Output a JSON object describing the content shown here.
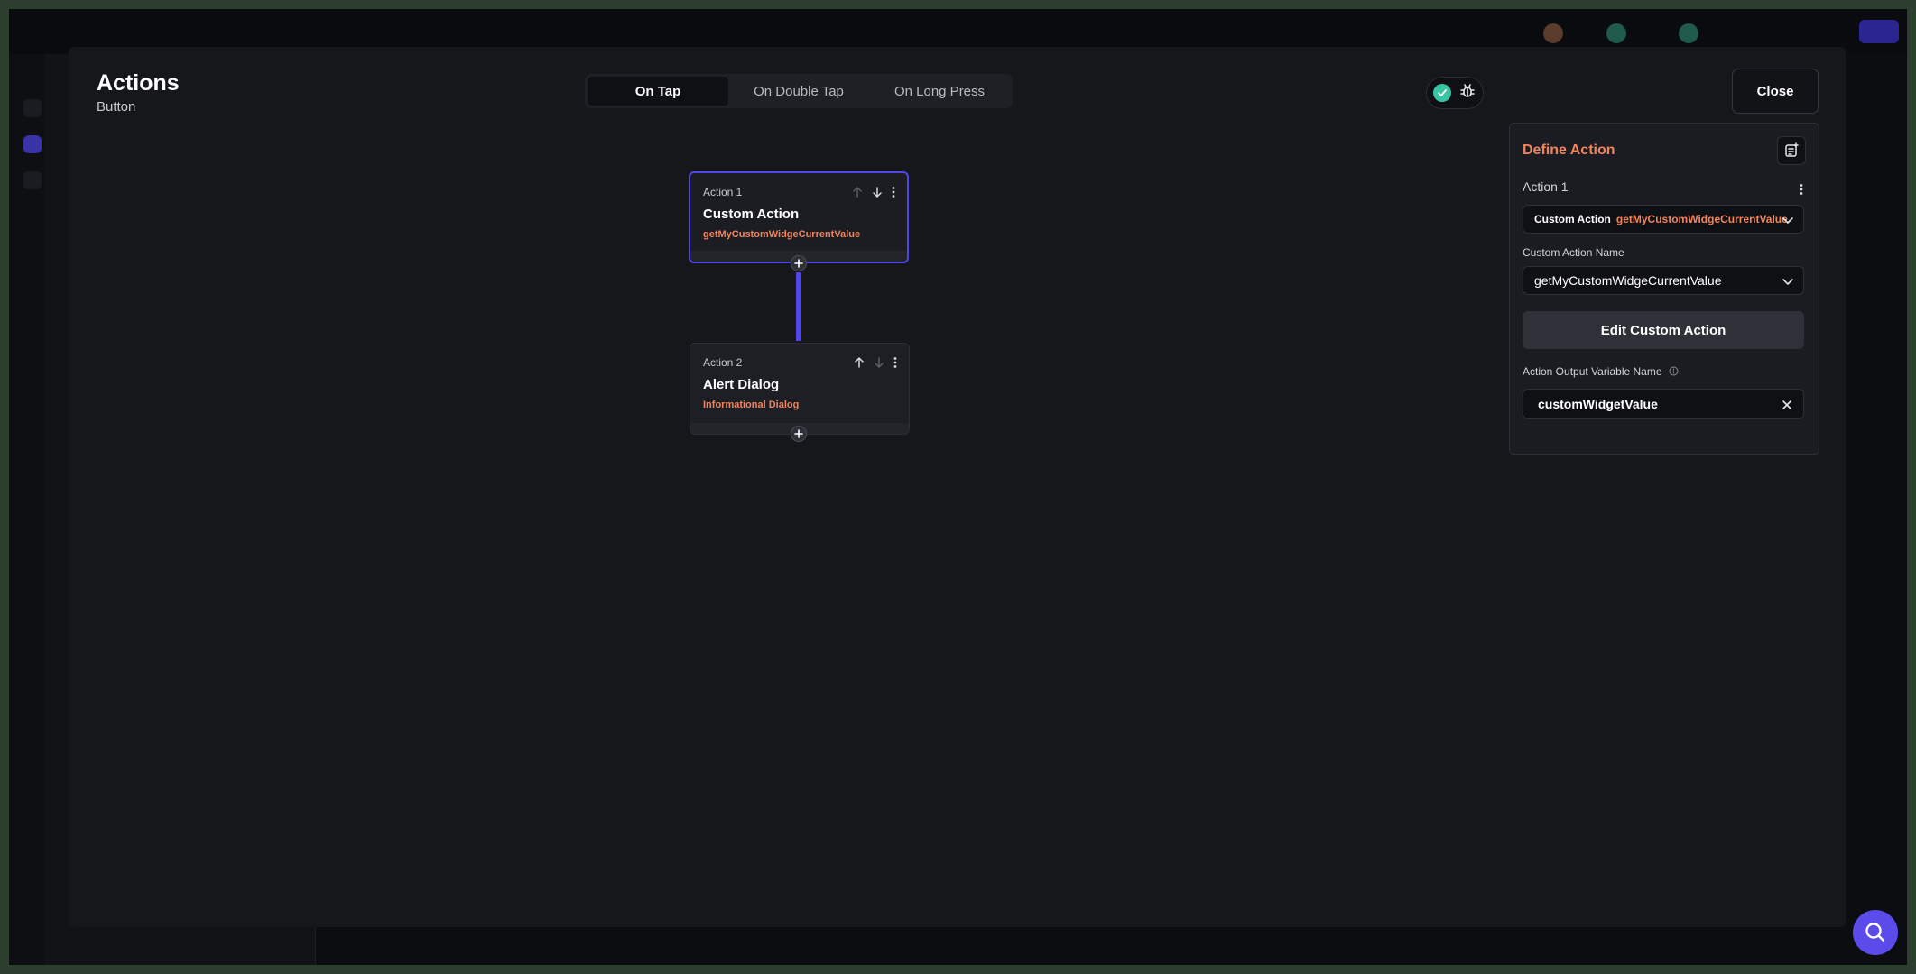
{
  "modal": {
    "title": "Actions",
    "subtitle": "Button",
    "tabs": [
      {
        "label": "On Tap",
        "active": true
      },
      {
        "label": "On Double Tap",
        "active": false
      },
      {
        "label": "On Long Press",
        "active": false
      }
    ],
    "close_label": "Close",
    "status_icons": [
      "check-circle-icon",
      "bug-icon"
    ]
  },
  "flow": {
    "actions": [
      {
        "label": "Action 1",
        "title": "Custom Action",
        "subtitle": "getMyCustomWidgeCurrentValue",
        "selected": true
      },
      {
        "label": "Action 2",
        "title": "Alert Dialog",
        "subtitle": "Informational Dialog",
        "selected": false
      }
    ]
  },
  "panel": {
    "title": "Define Action",
    "action_label": "Action 1",
    "action_type": "Custom Action",
    "action_type_value": "getMyCustomWidgeCurrentValue",
    "custom_action_name_label": "Custom Action Name",
    "custom_action_name_value": "getMyCustomWidgeCurrentValue",
    "edit_button_label": "Edit Custom Action",
    "output_var_label": "Action Output Variable Name",
    "output_var_value": "customWidgetValue"
  },
  "colors": {
    "accent": "#f0845d",
    "primary": "#4f46e5",
    "success": "#39c5a3"
  }
}
